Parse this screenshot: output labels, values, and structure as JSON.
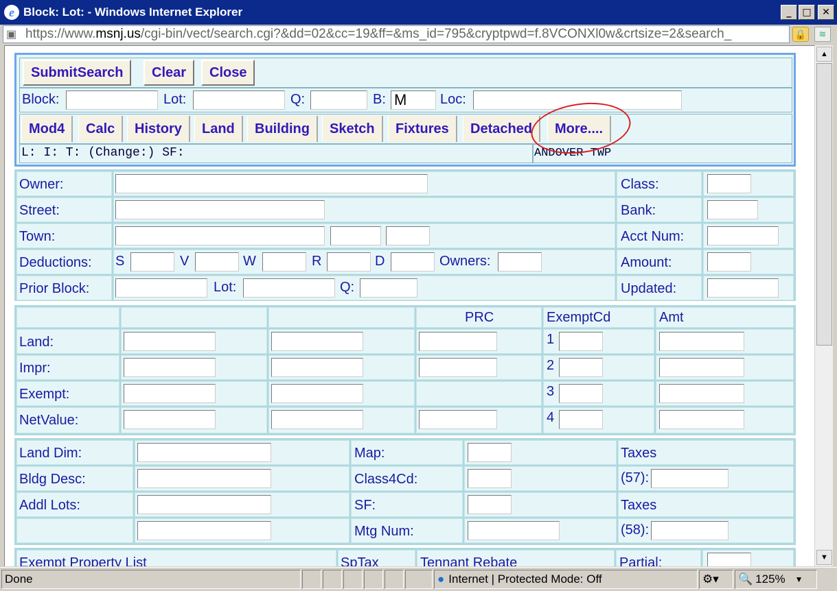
{
  "window": {
    "title": "Block: Lot: - Windows Internet Explorer",
    "minimize": "_",
    "maximize": "□",
    "close": "✕"
  },
  "address": {
    "url_prefix": "https://www.",
    "url_domain": "msnj.us",
    "url_rest": "/cgi-bin/vect/search.cgi?&dd=02&cc=19&ff=&ms_id=795&cryptpwd=f.8VCONXl0w&crtsize=2&search_"
  },
  "toolbar": {
    "submit_label": "SubmitSearch",
    "clear_label": "Clear",
    "close_label": "Close"
  },
  "search": {
    "block_label": "Block:",
    "lot_label": "Lot:",
    "q_label": "Q:",
    "b_label": "B:",
    "b_value": "M",
    "loc_label": "Loc:"
  },
  "tabs": [
    "Mod4",
    "Calc",
    "History",
    "Land",
    "Building",
    "Sketch",
    "Fixtures",
    "Detached",
    "More...."
  ],
  "info_line": {
    "left": "L: I: T: (Change:) SF:",
    "right": "ANDOVER  TWP"
  },
  "owner_section": {
    "owner_label": "Owner:",
    "street_label": "Street:",
    "town_label": "Town:",
    "deductions_label": "Deductions:",
    "prior_block_label": "Prior Block:",
    "ded_s": "S",
    "ded_v": "V",
    "ded_w": "W",
    "ded_r": "R",
    "ded_d": "D",
    "owners_label": "Owners:",
    "lot_label": "Lot:",
    "q_label": "Q:",
    "class_label": "Class:",
    "bank_label": "Bank:",
    "acct_label": "Acct Num:",
    "amount_label": "Amount:",
    "updated_label": "Updated:"
  },
  "value_section": {
    "prc_header": "PRC",
    "exemptcd_header": "ExemptCd",
    "amt_header": "Amt",
    "rows": [
      "Land:",
      "Impr:",
      "Exempt:",
      "NetValue:"
    ],
    "exempt_nums": [
      "1",
      "2",
      "3",
      "4"
    ]
  },
  "land_section": {
    "land_dim_label": "Land Dim:",
    "bldg_desc_label": "Bldg Desc:",
    "addl_lots_label": "Addl Lots:",
    "map_label": "Map:",
    "class4cd_label": "Class4Cd:",
    "sf_label": "SF:",
    "mtg_num_label": "Mtg Num:",
    "taxes1_label": "Taxes",
    "taxes57_label": "(57):",
    "taxes2_label": "Taxes",
    "taxes58_label": "(58):"
  },
  "bottom_row": {
    "exempt_list": "Exempt Property List",
    "sptax": "SpTax",
    "rebate": "Tennant Rebate",
    "partial": "Partial:"
  },
  "status": {
    "text": "Done",
    "zone": "Internet | Protected Mode: Off",
    "zoom": "125%"
  }
}
